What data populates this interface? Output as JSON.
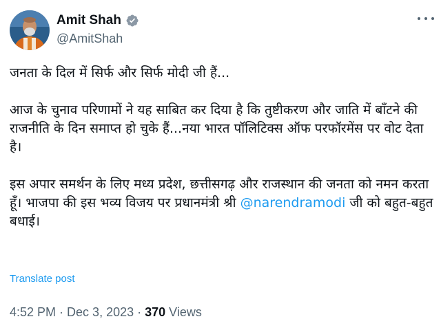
{
  "author": {
    "display_name": "Amit Shah",
    "handle": "@AmitShah",
    "verified_icon": "verified-badge-icon",
    "avatar_icon": "profile-avatar"
  },
  "tweet": {
    "line1": "जनता के दिल में सिर्फ और सिर्फ मोदी जी हैं...",
    "line2": "आज के चुनाव परिणामों ने यह साबित कर दिया है कि तुष्टीकरण और जाति में बाँटने की",
    "line3": "राजनीति के दिन समाप्त हो चुके हैं...नया भारत पॉलिटिक्स ऑफ परफॉरमेंस पर वोट देता",
    "line4": "है।",
    "line5": "इस अपार समर्थन के लिए मध्य प्रदेश, छत्तीसगढ़ और राजस्थान की जनता को नमन करता",
    "line6": "हूँ। भाजपा की इस भव्य विजय पर प्रधानमंत्री श्री ",
    "mention": "@narendramodi",
    "line6_after": " जी को बहुत-बहुत",
    "line7": "बधाई।"
  },
  "translate_label": "Translate post",
  "meta": {
    "time": "4:52 PM",
    "separator": " · ",
    "date": "Dec 3, 2023",
    "views_count": "370",
    "views_label": " Views"
  },
  "colors": {
    "link": "#1d9bf0",
    "secondary_text": "#536471",
    "primary_text": "#0f1419"
  }
}
